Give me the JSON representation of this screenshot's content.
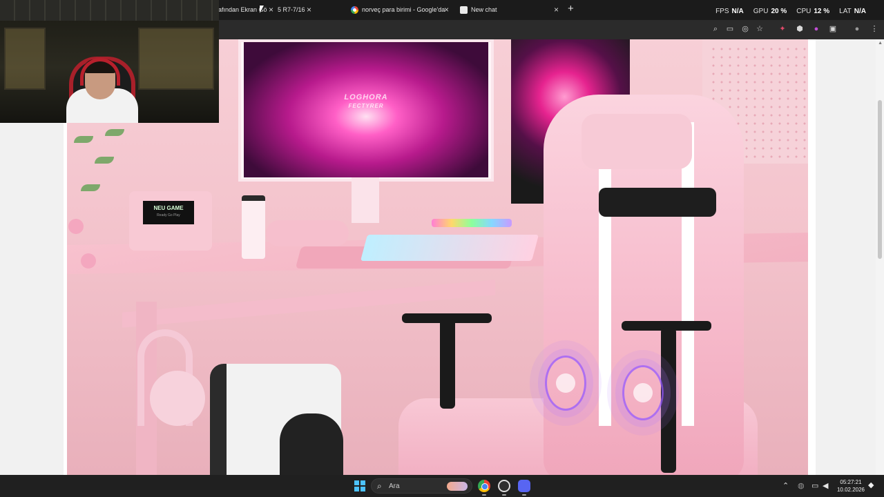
{
  "browser": {
    "tabs": [
      {
        "label": "afından Ekran Gö",
        "icon": "webpage-icon"
      },
      {
        "label": "5 R7-7/16",
        "icon": "webpage-icon"
      },
      {
        "label": "norveç para birimi - Google'da",
        "icon": "google-icon"
      },
      {
        "label": "New chat",
        "icon": "chat-icon"
      }
    ],
    "new_tab_symbol": "+",
    "close_symbol": "×"
  },
  "perf_overlay": {
    "fps_label": "FPS",
    "fps_value": "N/A",
    "gpu_label": "GPU",
    "gpu_value": "20 %",
    "cpu_label": "CPU",
    "cpu_value": "12 %",
    "lat_label": "LAT",
    "lat_value": "N/A"
  },
  "product": {
    "monitor_logo": "LOGHORA",
    "monitor_logo_sub": "FECTYRER",
    "console_screen": "NEU GAME",
    "console_screen_sub": "Ready Go Play"
  },
  "taskbar": {
    "search_placeholder": "Ara",
    "time": "05:27:21",
    "date": "10.02.2026",
    "apps": [
      "chrome-icon",
      "obs-icon",
      "discord-icon"
    ]
  },
  "colors": {
    "accent_blue": "#4cc2ff",
    "page_pink": "#f3c3cc",
    "webcam_chair_red": "#a8202a"
  }
}
